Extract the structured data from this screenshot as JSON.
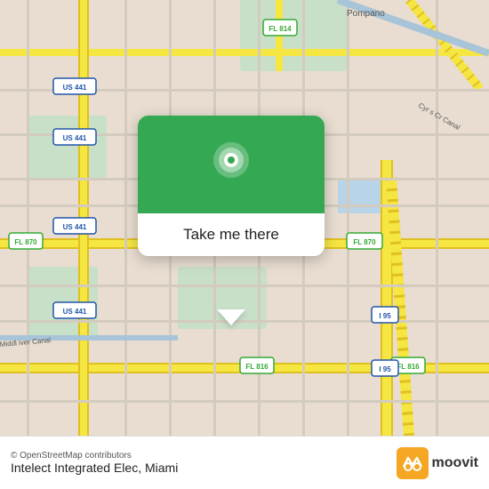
{
  "map": {
    "attribution": "© OpenStreetMap contributors",
    "background_color": "#e8e0d8"
  },
  "popup": {
    "button_label": "Take me there"
  },
  "bottom_bar": {
    "location_name": "Intelect Integrated Elec, Miami"
  },
  "moovit": {
    "logo_text": "moovit"
  }
}
